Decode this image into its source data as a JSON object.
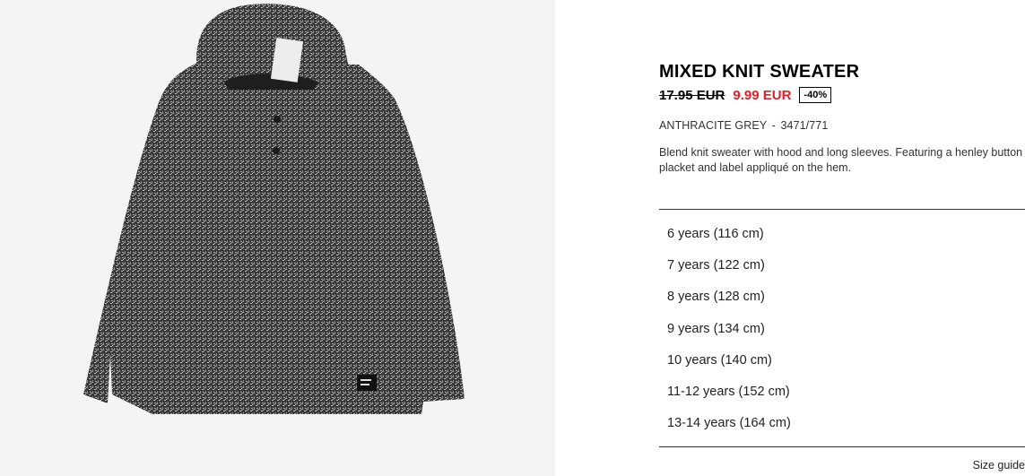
{
  "product": {
    "title": "MIXED KNIT SWEATER",
    "old_price": "17.95 EUR",
    "new_price": "9.99 EUR",
    "discount": "-40%",
    "color": "ANTHRACITE GREY",
    "ref_separator": "-",
    "reference": "3471/771",
    "description": "Blend knit sweater with hood and long sleeves. Featuring a henley button placket and label appliqué on the hem.",
    "image_alt": "mixed-knit-sweater-photo"
  },
  "sizes": [
    "6 years (116 cm)",
    "7 years (122 cm)",
    "8 years (128 cm)",
    "9 years (134 cm)",
    "10 years (140 cm)",
    "11-12 years (152 cm)",
    "13-14 years (164 cm)"
  ],
  "size_guide_label": "Size guide",
  "colors": {
    "sale_red": "#e2202a",
    "image_bg": "#f4f4f4",
    "sweater": "#4a4a4a"
  }
}
